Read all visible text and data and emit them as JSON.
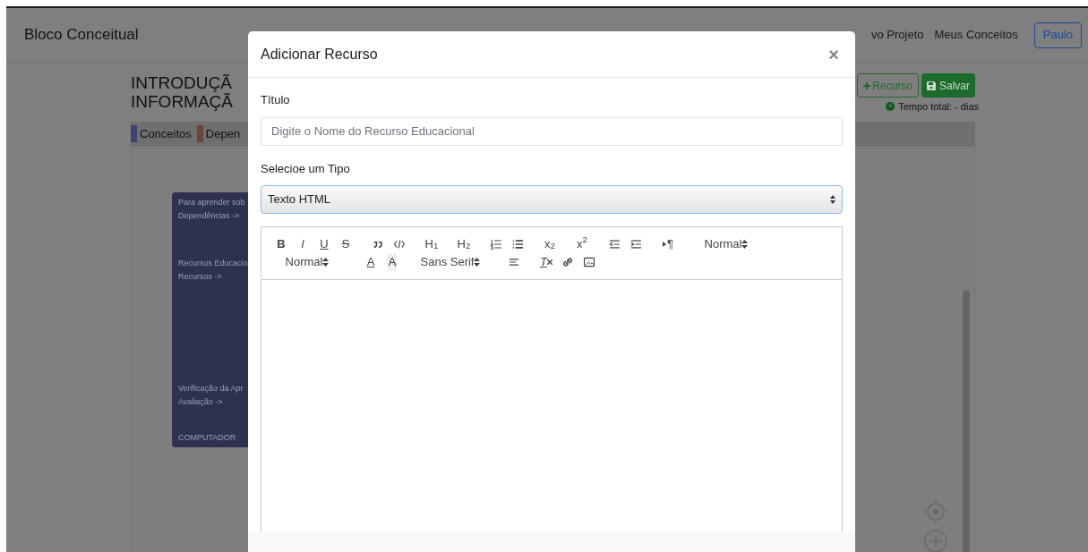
{
  "navbar": {
    "brand": "Bloco Conceitual",
    "links": [
      "vo Projeto",
      "Meus Conceitos"
    ],
    "user_button": "Paulo"
  },
  "page": {
    "title_lines": [
      "INTRODUÇÃ",
      "INFORMAÇÃ"
    ],
    "legend": [
      {
        "label": "Conceitos",
        "color": "#3c4272"
      },
      {
        "label": "Depen",
        "color": "#6b4538"
      }
    ],
    "add_button": "Recurso",
    "save_button": "Salvar",
    "total_time": "Tempo total: - dias",
    "concept_node": {
      "sections": [
        [
          "Para aprender sob",
          "Dependências ->"
        ],
        [
          "Recursos Educacio",
          "Recursos ->"
        ],
        [
          "Verificação da Apr",
          "Avaliação ->"
        ],
        [
          "COMPUTADOR"
        ]
      ]
    }
  },
  "modal": {
    "title": "Adicionar Recurso",
    "close": "×",
    "title_field": {
      "label": "Título",
      "placeholder": "Digite o Nome do Recurso Educacional"
    },
    "type_field": {
      "label": "Selecioe um Tipo",
      "value": "Texto HTML"
    },
    "toolbar_rows": [
      [
        {
          "kind": "bold",
          "label": "B"
        },
        {
          "kind": "italic",
          "label": "I"
        },
        {
          "kind": "underline",
          "label": "U"
        },
        {
          "kind": "strike",
          "label": "S"
        },
        {
          "kind": "blockquote"
        },
        {
          "kind": "code"
        },
        {
          "kind": "header",
          "label": "H$_{1}$"
        },
        {
          "kind": "header",
          "label": "H$_{2}$"
        },
        {
          "kind": "ordered"
        },
        {
          "kind": "bullet"
        },
        {
          "kind": "script",
          "label": "x$_{2}$"
        },
        {
          "kind": "script",
          "label": "x$^{2}$"
        },
        {
          "kind": "outdent"
        },
        {
          "kind": "indent"
        },
        {
          "kind": "direction",
          "label": "¶"
        },
        {
          "kind": "picker",
          "label": "Normal"
        }
      ],
      [
        {
          "kind": "picker",
          "label": "Normal"
        },
        {
          "kind": "color",
          "label": "A"
        },
        {
          "kind": "background",
          "label": "A"
        },
        {
          "kind": "picker",
          "label": "Sans Serif"
        },
        {
          "kind": "align"
        },
        {
          "kind": "clean",
          "label": "T"
        },
        {
          "kind": "link"
        },
        {
          "kind": "image"
        }
      ]
    ]
  }
}
